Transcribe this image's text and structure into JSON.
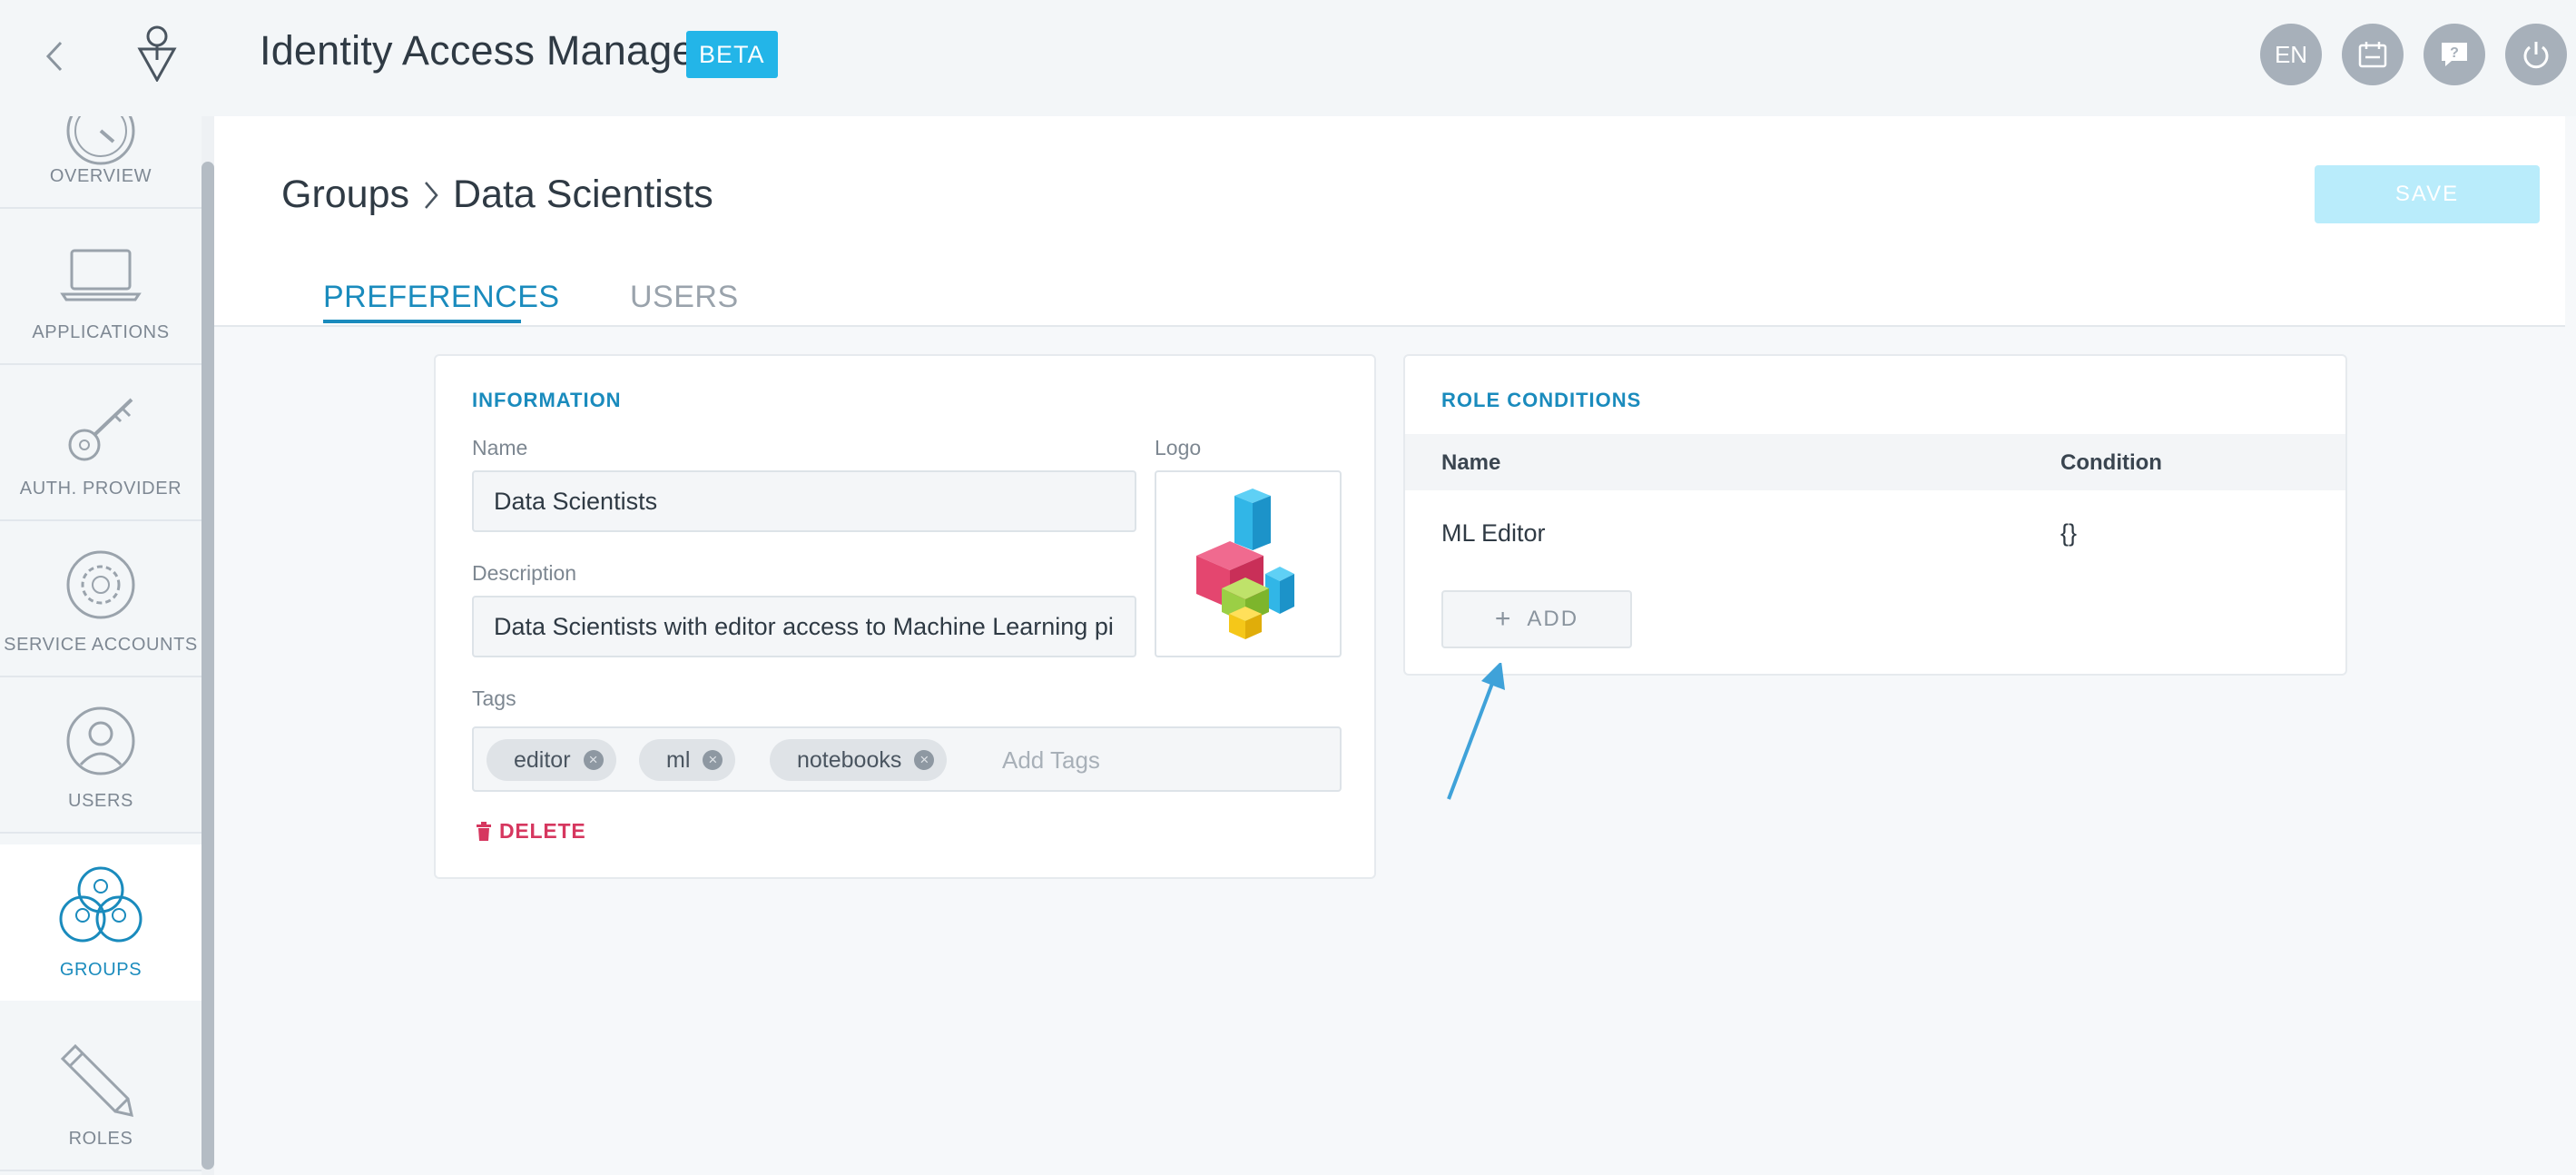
{
  "header": {
    "app_title": "Identity Access Manager",
    "beta_label": "BETA",
    "lang_label": "EN",
    "icons": [
      "chevron-left-icon",
      "app-logo-icon",
      "calendar-icon",
      "help-icon",
      "power-icon"
    ]
  },
  "sidebar": {
    "items": [
      {
        "label": "OVERVIEW",
        "icon": "speedometer-icon"
      },
      {
        "label": "APPLICATIONS",
        "icon": "laptop-icon"
      },
      {
        "label": "AUTH. PROVIDER",
        "icon": "key-icon"
      },
      {
        "label": "SERVICE ACCOUNTS",
        "icon": "gear-icon"
      },
      {
        "label": "USERS",
        "icon": "user-icon"
      },
      {
        "label": "GROUPS",
        "icon": "group-icon",
        "active": true
      },
      {
        "label": "ROLES",
        "icon": "pencil-icon"
      }
    ]
  },
  "main": {
    "breadcrumb": {
      "parent": "Groups",
      "current": "Data Scientists"
    },
    "save_label": "SAVE",
    "tabs": [
      {
        "label": "PREFERENCES",
        "active": true
      },
      {
        "label": "USERS",
        "active": false
      }
    ]
  },
  "information": {
    "title": "INFORMATION",
    "name_label": "Name",
    "name_value": "Data Scientists",
    "logo_label": "Logo",
    "description_label": "Description",
    "description_value": "Data Scientists with editor access to Machine Learning pipe",
    "tags_label": "Tags",
    "tags": [
      "editor",
      "ml",
      "notebooks"
    ],
    "tags_placeholder": "Add Tags",
    "delete_label": "DELETE"
  },
  "role_conditions": {
    "title": "ROLE CONDITIONS",
    "columns": {
      "name": "Name",
      "condition": "Condition"
    },
    "rows": [
      {
        "name": "ML Editor",
        "condition": "{}"
      }
    ],
    "add_label": "ADD"
  },
  "colors": {
    "accent": "#1a8bbd",
    "beta": "#23b5e8",
    "save_disabled": "#b9ecfb",
    "danger": "#d6375f"
  }
}
